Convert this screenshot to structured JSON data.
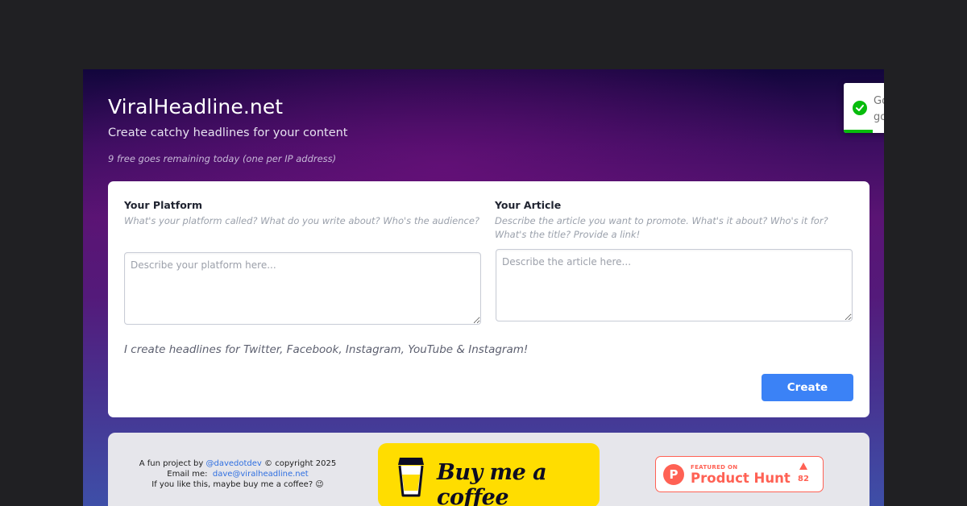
{
  "header": {
    "title": "ViralHeadline.net",
    "subtitle": "Create catchy headlines for your content",
    "remaining": "9 free goes remaining today (one per IP address)"
  },
  "toast": {
    "message": "Go\ngo",
    "icon": "check-circle-icon",
    "color": "#07bc0c",
    "progress": 0.52
  },
  "form": {
    "platform": {
      "label": "Your Platform",
      "help": "What's your platform called? What do you write about? Who's the audience?",
      "value": "",
      "placeholder": "Describe your platform here..."
    },
    "article": {
      "label": "Your Article",
      "help": "Describe the article you want to promote. What's it about? Who's it for? What's the title? Provide a link!",
      "value": "",
      "placeholder": "Describe the article here..."
    },
    "platforms_note": "I create headlines for Twitter, Facebook, Instagram, YouTube & Instagram!",
    "create_label": "Create",
    "accent": "#3b82f6"
  },
  "footer": {
    "credit_prefix": "A fun project by ",
    "credit_handle": "@davedotdev",
    "credit_suffix": " © copyright 2025",
    "email_prefix": "Email me: ",
    "email": "dave@viralheadline.net",
    "coffee_line": "If you like this, maybe buy me a coffee? 😉",
    "bmc_label": "Buy me a coffee",
    "bmc_color": "#ffdd00",
    "ph_featured": "FEATURED ON",
    "ph_name": "Product Hunt",
    "ph_votes": "82",
    "ph_color": "#ff6154"
  }
}
